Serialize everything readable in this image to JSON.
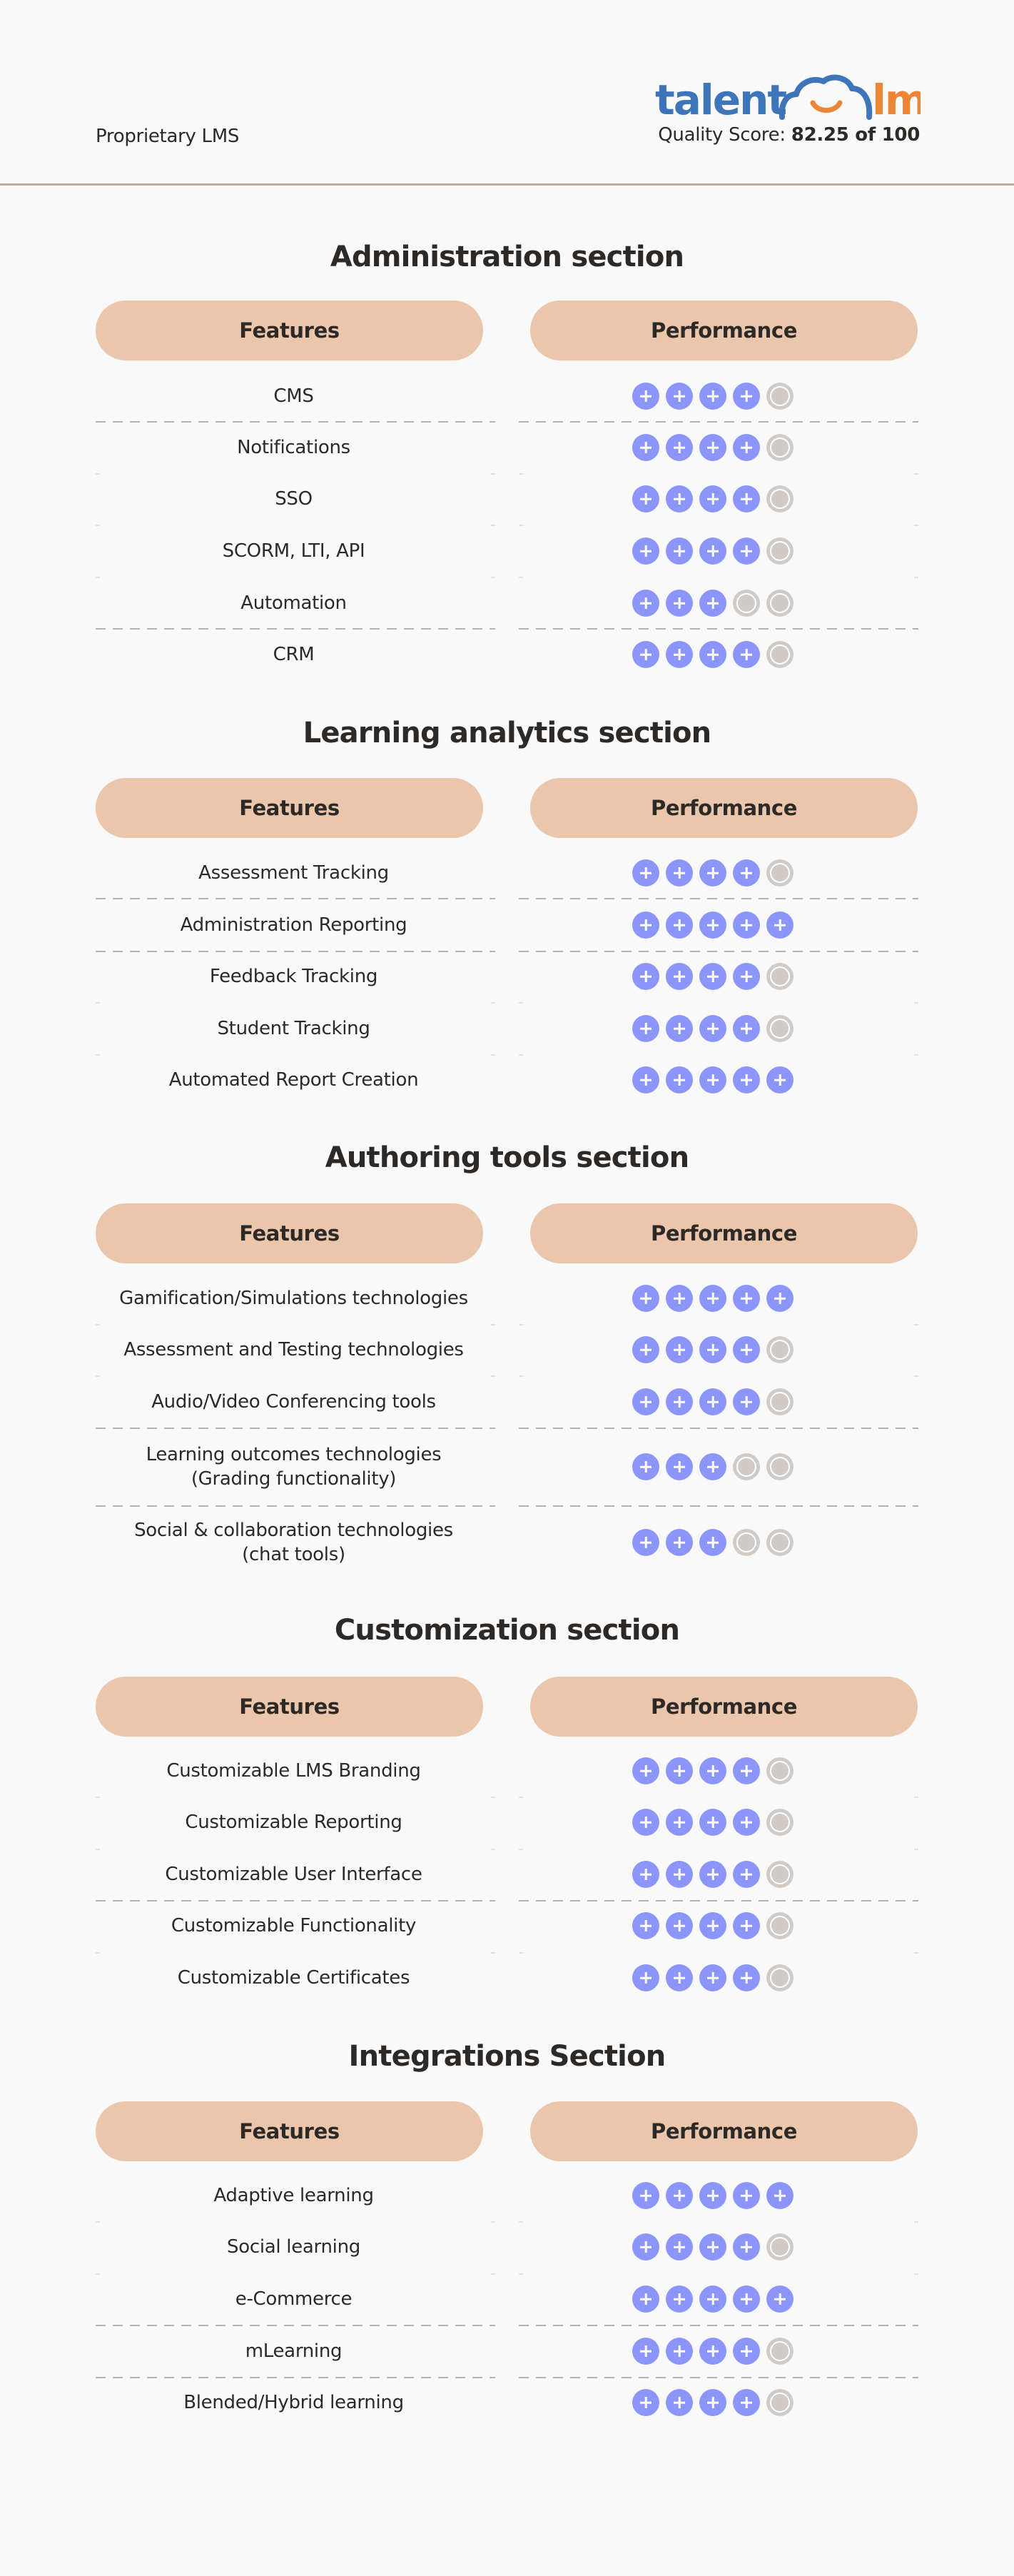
{
  "header": {
    "product_type": "Proprietary LMS",
    "logo": {
      "name": "talentlms",
      "word_left": "talent",
      "word_right": "lms",
      "icon": "smiling-cloud-icon",
      "colors": {
        "blue": "#3d74ba",
        "orange": "#ec8535"
      }
    },
    "quality_score_label": "Quality Score:",
    "quality_score_value": "82.25 of 100"
  },
  "columns": {
    "features": "Features",
    "performance": "Performance"
  },
  "rating_scale": {
    "max": 5,
    "filled_icon": "plus-circle-icon",
    "empty_icon": "empty-circle-icon",
    "filled_color": "#8c96fa",
    "empty_color": "#d1cbc8"
  },
  "sections": [
    {
      "title": "Administration section",
      "rows": [
        {
          "feature": "CMS",
          "rating": 4
        },
        {
          "feature": "Notifications",
          "rating": 4
        },
        {
          "feature": "SSO",
          "rating": 4
        },
        {
          "feature": "SCORM, LTI, API",
          "rating": 4
        },
        {
          "feature": "Automation",
          "rating": 3
        },
        {
          "feature": "CRM",
          "rating": 4
        }
      ]
    },
    {
      "title": "Learning analytics section",
      "rows": [
        {
          "feature": "Assessment Tracking",
          "rating": 4
        },
        {
          "feature": "Administration Reporting",
          "rating": 5
        },
        {
          "feature": "Feedback Tracking",
          "rating": 4
        },
        {
          "feature": "Student Tracking",
          "rating": 4
        },
        {
          "feature": "Automated Report Creation",
          "rating": 5
        }
      ]
    },
    {
      "title": "Authoring tools section",
      "rows": [
        {
          "feature": "Gamification/Simulations technologies",
          "rating": 5
        },
        {
          "feature": "Assessment and Testing technologies",
          "rating": 4
        },
        {
          "feature": "Audio/Video Conferencing tools",
          "rating": 4
        },
        {
          "feature": "Learning outcomes technologies\n(Grading functionality)",
          "rating": 3
        },
        {
          "feature": "Social & collaboration technologies\n(chat tools)",
          "rating": 3
        }
      ]
    },
    {
      "title": "Customization section",
      "rows": [
        {
          "feature": "Customizable LMS Branding",
          "rating": 4
        },
        {
          "feature": "Customizable Reporting",
          "rating": 4
        },
        {
          "feature": "Customizable User Interface",
          "rating": 4
        },
        {
          "feature": "Customizable Functionality",
          "rating": 4
        },
        {
          "feature": "Customizable Certificates",
          "rating": 4
        }
      ]
    },
    {
      "title": "Integrations Section",
      "rows": [
        {
          "feature": "Adaptive learning",
          "rating": 5
        },
        {
          "feature": "Social learning",
          "rating": 4
        },
        {
          "feature": "e-Commerce",
          "rating": 5
        },
        {
          "feature": "mLearning",
          "rating": 4
        },
        {
          "feature": "Blended/Hybrid learning",
          "rating": 4
        }
      ]
    }
  ]
}
